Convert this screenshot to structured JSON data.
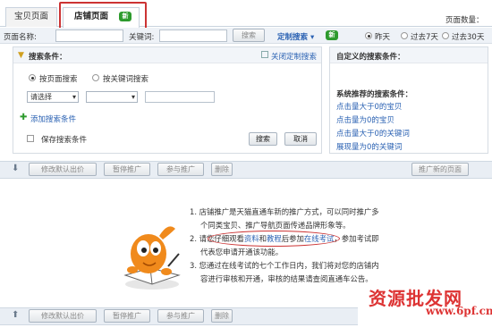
{
  "tabs": [
    {
      "label": "宝贝页面"
    },
    {
      "label": "店铺页面"
    }
  ],
  "new_badge": "新",
  "page_count_label": "页面数量：",
  "search": {
    "page_name_label": "页面名称:",
    "page_name_value": "",
    "keyword_label": "关键词:",
    "keyword_value": "",
    "search_button": "搜索",
    "custom_search": "定制搜索",
    "custom_badge": "新",
    "time_options": [
      "昨天",
      "过去7天",
      "过去30天"
    ],
    "time_selected": "昨天"
  },
  "conditions": {
    "title": "搜索条件：",
    "close_custom": "关闭定制搜索",
    "mode_options": [
      "按页面搜索",
      "按关键词搜索"
    ],
    "mode_selected": "按页面搜索",
    "select1": "请选择",
    "select2": "",
    "value": "",
    "add_condition": "添加搜索条件",
    "save_condition": "保存搜索条件",
    "search_button": "搜索",
    "cancel_button": "取消"
  },
  "custom_panel": {
    "title": "自定义的搜索条件：",
    "recommended_title": "系统推荐的搜索条件：",
    "items": [
      "点击量大于0的宝贝",
      "点击量为0的宝贝",
      "点击量大于0的关键词",
      "展现量为0的关键词"
    ]
  },
  "toolbar": {
    "modify_bid": "修改默认出价",
    "pause": "暂停推广",
    "join": "参与推广",
    "delete": "删除",
    "promote_new": "推广新的页面"
  },
  "info": {
    "line1": "1. 店铺推广是天猫直通车新的推广方式，可以同时推广多",
    "line2": "个同类宝贝、推广导航页面传递品牌形象等。",
    "line3a": "2. 请您仔细观看",
    "link1": "资料",
    "line3b": "和",
    "link2": "教程",
    "line3c": "后参加",
    "link3": "在线考试",
    "line3d": "，参加考试即",
    "line4": "代表您申请开通该功能。",
    "line5": "3. 您通过在线考试的七个工作日内，我们将对您的店铺内",
    "line6": "容进行审核和开通，审核的结果请查阅直通车公告。"
  },
  "watermark": {
    "cn": "资源批发网",
    "url": "www.6pf.cn"
  }
}
